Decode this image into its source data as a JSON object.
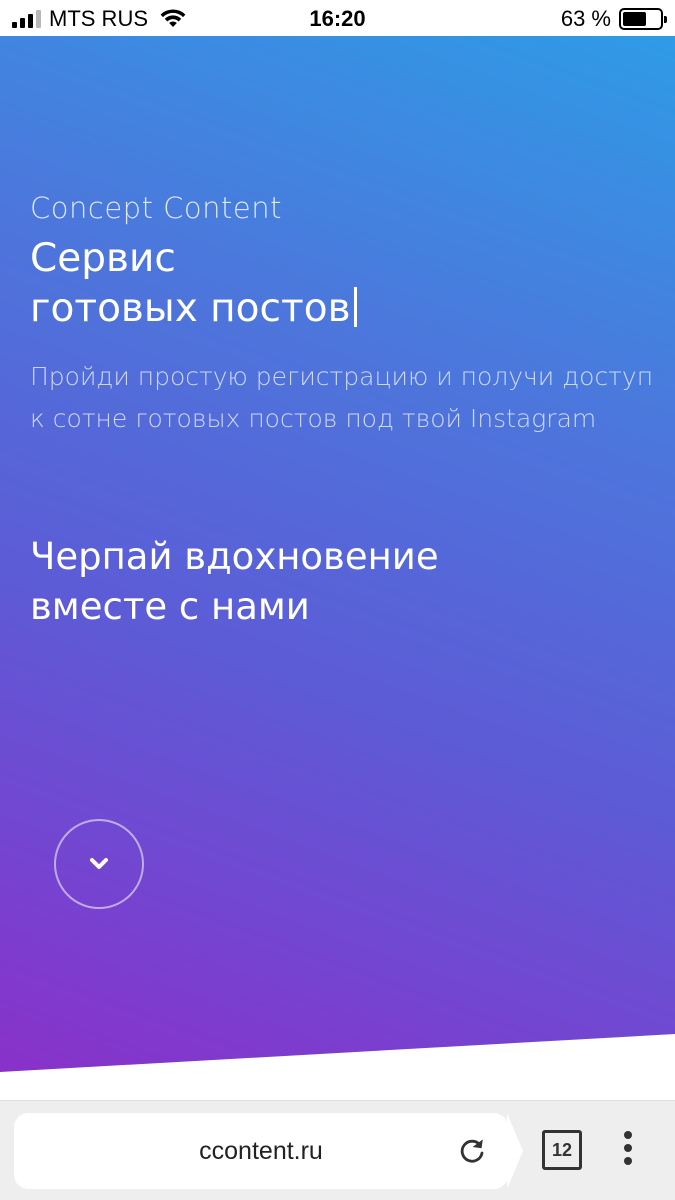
{
  "status_bar": {
    "carrier": "MTS RUS",
    "time": "16:20",
    "battery": "63 %",
    "battery_level": 0.63
  },
  "hero": {
    "brand": "Concept Content",
    "headline_line1": "Сервис",
    "headline_line2": "готовых постов",
    "description": "Пройди простую регистрацию и получи доступ к сотне готовых постов под твой Instagram",
    "tagline_line1": "Черпай вдохновение",
    "tagline_line2": "вместе с нами",
    "scroll_icon": "chevron-down-icon",
    "gradient_colors": [
      "#2f9be6",
      "#5d5bd6",
      "#8b2fc8"
    ]
  },
  "browser": {
    "url": "ccontent.ru",
    "tab_count": "12",
    "reload_icon": "reload-icon",
    "menu_icon": "more-vertical-icon"
  }
}
